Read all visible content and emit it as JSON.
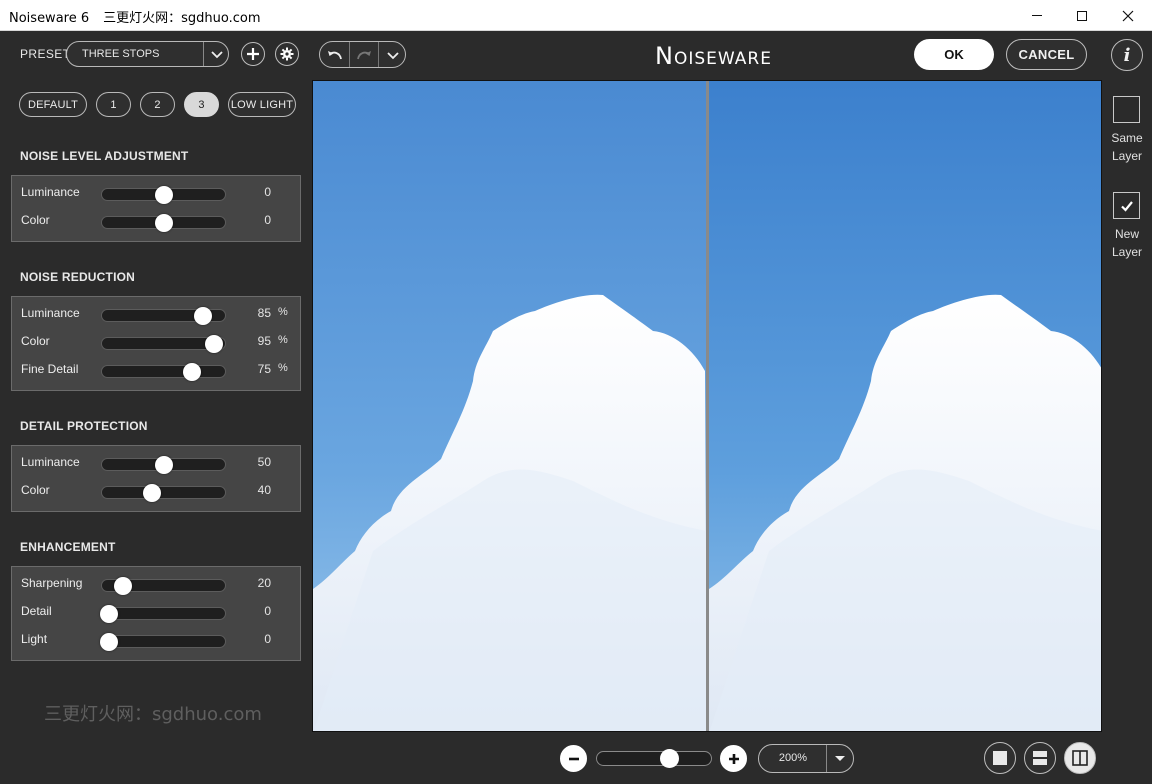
{
  "window": {
    "title": "Noiseware 6",
    "subtitle": "三更灯火网：sgdhuo.com"
  },
  "toolbar": {
    "preset_label": "PRESET",
    "preset_value": "THREE STOPS",
    "brand": "Noiseware",
    "ok_label": "OK",
    "cancel_label": "CANCEL",
    "info_label": "i"
  },
  "preset_buttons": {
    "default": "DEFAULT",
    "p1": "1",
    "p2": "2",
    "p3": "3",
    "low_light": "LOW LIGHT",
    "active": "3"
  },
  "sections": {
    "noise_level": {
      "title": "NOISE LEVEL ADJUSTMENT",
      "rows": [
        {
          "label": "Luminance",
          "value": "0",
          "unit": "",
          "fraction": 0.5
        },
        {
          "label": "Color",
          "value": "0",
          "unit": "",
          "fraction": 0.5
        }
      ]
    },
    "noise_reduction": {
      "title": "NOISE REDUCTION",
      "rows": [
        {
          "label": "Luminance",
          "value": "85",
          "unit": "%",
          "fraction": 0.82
        },
        {
          "label": "Color",
          "value": "95",
          "unit": "%",
          "fraction": 0.91
        },
        {
          "label": "Fine Detail",
          "value": "75",
          "unit": "%",
          "fraction": 0.73
        }
      ]
    },
    "detail_protection": {
      "title": "DETAIL PROTECTION",
      "rows": [
        {
          "label": "Luminance",
          "value": "50",
          "unit": "",
          "fraction": 0.5
        },
        {
          "label": "Color",
          "value": "40",
          "unit": "",
          "fraction": 0.41
        }
      ]
    },
    "enhancement": {
      "title": "ENHANCEMENT",
      "rows": [
        {
          "label": "Sharpening",
          "value": "20",
          "unit": "",
          "fraction": 0.17
        },
        {
          "label": "Detail",
          "value": "0",
          "unit": "",
          "fraction": 0.0
        },
        {
          "label": "Light",
          "value": "0",
          "unit": "",
          "fraction": 0.0
        }
      ]
    }
  },
  "watermark": "三更灯火网：sgdhuo.com",
  "layers": {
    "same": {
      "label_line1": "Same",
      "label_line2": "Layer",
      "checked": false
    },
    "new": {
      "label_line1": "New",
      "label_line2": "Layer",
      "checked": true
    }
  },
  "zoom": {
    "level": "200%",
    "fraction": 0.64
  },
  "icons": {
    "add": "plus-icon",
    "settings": "gear-icon",
    "undo": "undo-icon",
    "redo": "redo-icon",
    "history": "chevron-down-icon",
    "zoom_out": "minus-icon",
    "zoom_in": "plus-icon",
    "view_single": "single-view-icon",
    "view_split_h": "split-horizontal-icon",
    "view_split_v": "split-vertical-icon"
  },
  "colors": {
    "background": "#2b2b2b",
    "panel": "#454545",
    "sky_top": "#3f82cf",
    "sky_bottom": "#8ec0e8",
    "cloud": "#f4f7fb"
  }
}
